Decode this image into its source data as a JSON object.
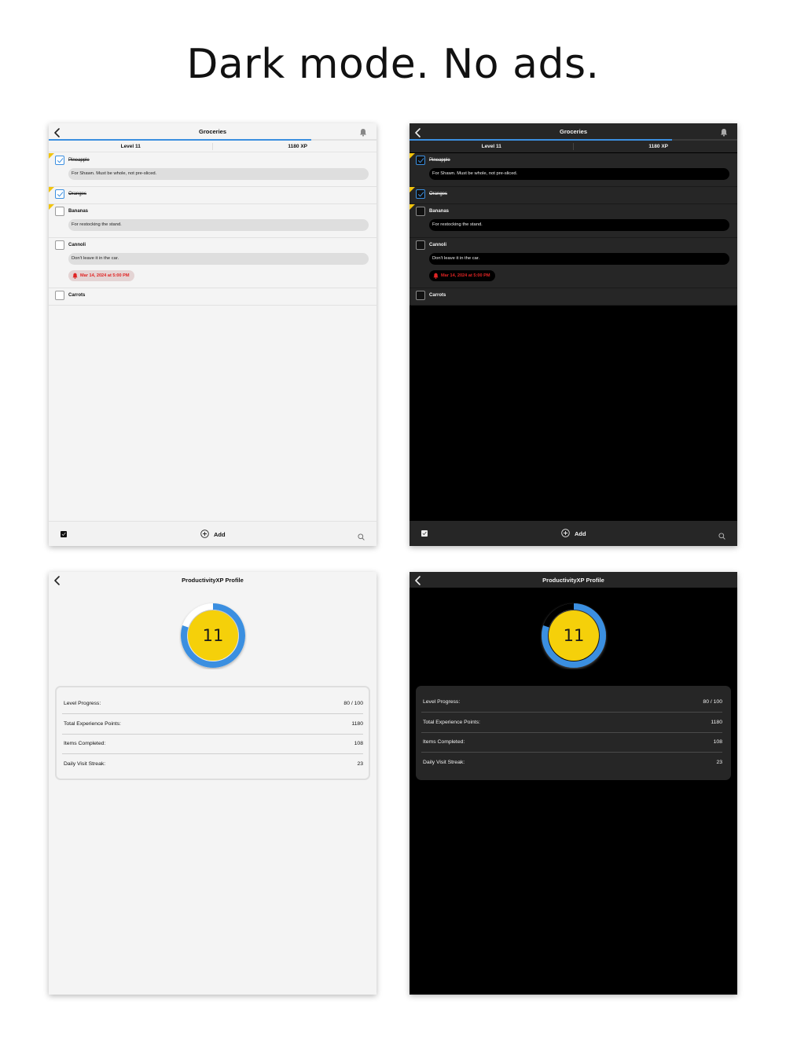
{
  "headline": "Dark mode. No ads.",
  "colors": {
    "accent_blue": "#3b8fe0",
    "flag_yellow": "#f1c40f",
    "level_yellow": "#f5d00a",
    "reminder_red": "#e02424",
    "dark_surface": "#262626",
    "light_surface": "#f4f4f4"
  },
  "list_screen": {
    "title": "Groceries",
    "level_label": "Level 11",
    "xp_label": "1180 XP",
    "level_progress_fraction": 0.8,
    "items": [
      {
        "title": "Pineapple",
        "checked": true,
        "flagged": true,
        "note": "For Shawn. Must be whole, not pre-sliced.",
        "reminder": ""
      },
      {
        "title": "Oranges",
        "checked": true,
        "flagged": true,
        "note": "",
        "reminder": ""
      },
      {
        "title": "Bananas",
        "checked": false,
        "flagged": true,
        "note": "For restocking the stand.",
        "reminder": ""
      },
      {
        "title": "Cannoli",
        "checked": false,
        "flagged": false,
        "note": "Don't leave it in the car.",
        "reminder": "Mar 14, 2024 at 5:00 PM"
      },
      {
        "title": "Carrots",
        "checked": false,
        "flagged": false,
        "note": "",
        "reminder": ""
      }
    ],
    "toolbar": {
      "add_label": "Add"
    },
    "icons": [
      "back-icon",
      "bell-icon",
      "checkbox-icon",
      "plus-circle-icon",
      "search-icon"
    ]
  },
  "profile_screen": {
    "title": "ProductivityXP Profile",
    "level_number": "11",
    "ring_progress_fraction": 0.8,
    "stats": [
      {
        "label": "Level Progress:",
        "value": "80 / 100"
      },
      {
        "label": "Total Experience Points:",
        "value": "1180"
      },
      {
        "label": "Items Completed:",
        "value": "108"
      },
      {
        "label": "Daily Visit Streak:",
        "value": "23"
      }
    ]
  }
}
